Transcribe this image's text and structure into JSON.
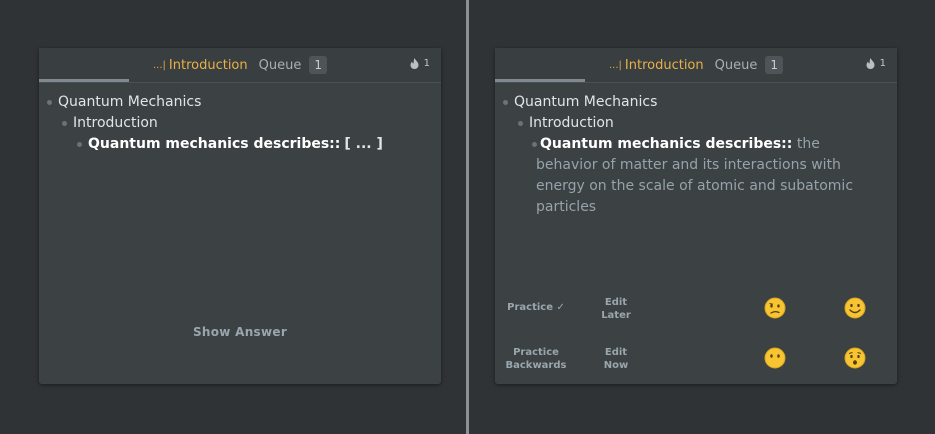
{
  "left_card": {
    "crumb_prefix": "...|",
    "crumb_title": "Introduction",
    "queue_label": "Queue",
    "queue_count": "1",
    "stat_count": "1",
    "tree": {
      "root": "Quantum Mechanics",
      "child": "Introduction",
      "question": "Quantum mechanics describes::",
      "cloze": "[ ... ]"
    },
    "show_answer": "Show Answer"
  },
  "right_card": {
    "crumb_prefix": "...|",
    "crumb_title": "Introduction",
    "queue_label": "Queue",
    "queue_count": "1",
    "stat_count": "1",
    "tree": {
      "root": "Quantum Mechanics",
      "child": "Introduction",
      "question": "Quantum mechanics describes::",
      "answer": "the behavior of matter and its interactions with energy on the scale of atomic and subatomic particles"
    },
    "buttons": {
      "practice": "Practice ✓",
      "edit_later_1": "Edit",
      "edit_later_2": "Later",
      "practice_backwards_1": "Practice",
      "practice_backwards_2": "Backwards",
      "edit_now_1": "Edit",
      "edit_now_2": "Now"
    },
    "faces": [
      "confused-face-icon",
      "smiling-face-icon",
      "neutral-face-icon",
      "worried-face-icon"
    ]
  },
  "colors": {
    "background": "#2f3336",
    "card": "#3c4144",
    "accent": "#e8b047",
    "muted_text": "#9aa6ad",
    "face_yellow": "#f7c531"
  }
}
